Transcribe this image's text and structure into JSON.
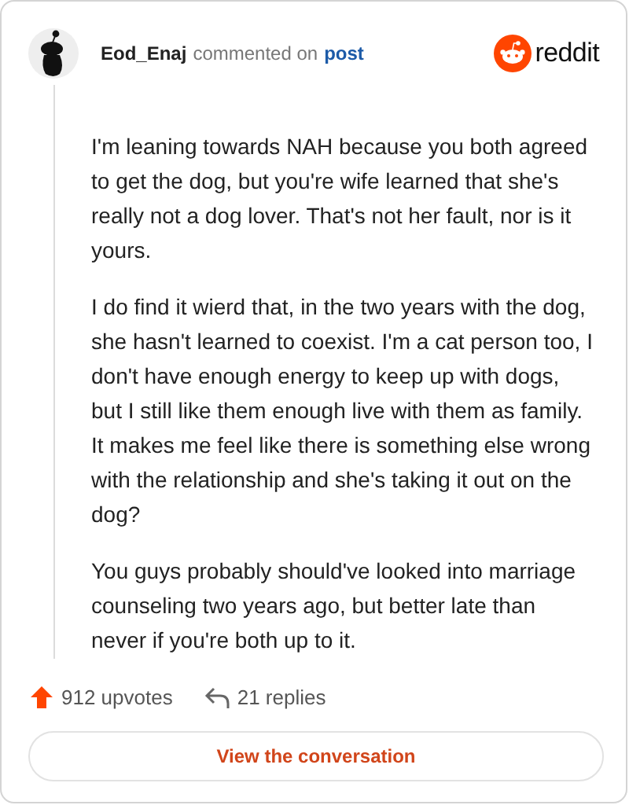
{
  "header": {
    "username": "Eod_Enaj",
    "action": "commented on",
    "link": "post",
    "brand": "reddit"
  },
  "paragraphs": [
    "I'm leaning towards NAH because you both agreed to get the dog, but you're wife learned that she's really not a dog lover. That's not her fault, nor is it yours.",
    "I do find it wierd that, in the two years with the dog, she hasn't learned to coexist. I'm a cat person too, I don't have enough energy to keep up with dogs, but I still like them enough live with them as family. It makes me feel like there is something else wrong with the relationship and she's taking it out on the dog?",
    "You guys probably should've looked into marriage counseling two years ago, but better late than never if you're both up to it."
  ],
  "stats": {
    "upvotes": "912 upvotes",
    "replies": "21 replies"
  },
  "button": "View the conversation"
}
